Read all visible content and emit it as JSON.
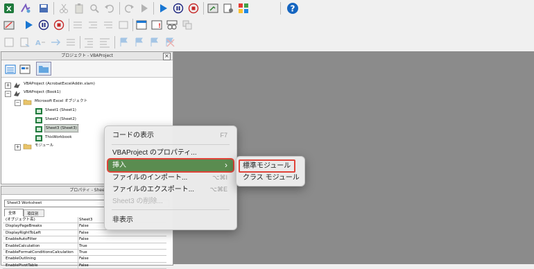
{
  "colors": {
    "highlight": "#5a8c50",
    "outline": "#e0443a",
    "code_bg": "#8b8b8b"
  },
  "toolbar": {
    "icons": [
      "excel-icon",
      "run-macro-icon",
      "save-icon",
      "cut-icon",
      "paste-icon",
      "find-icon",
      "undo-icon",
      "redo-icon",
      "play-icon",
      "run-icon",
      "pause-icon",
      "stop-icon",
      "design-mode-icon",
      "properties-icon",
      "toolbox-icon",
      "help-icon"
    ]
  },
  "project_pane": {
    "title": "プロジェクト - VBAProject",
    "close": "×",
    "tree": {
      "addin": "VBAProject (AcrobatExcelAddin.xlam)",
      "book": "VBAProject (Book1)",
      "objects_folder": "Microsoft Excel オブジェクト",
      "sheet1": "Sheet1 (Sheet1)",
      "sheet2": "Sheet2 (Sheet2)",
      "sheet3": "Sheet3 (Sheet3)",
      "thisworkbook": "ThisWorkbook",
      "modules_folder": "モジュール"
    }
  },
  "props_pane": {
    "title": "プロパティ - Shee",
    "object_select": "Sheet3  Worksheet",
    "tab_all": "全体",
    "tab_category": "項目別",
    "rows": [
      {
        "k": "(オブジェクト名)",
        "v": "Sheet3"
      },
      {
        "k": "DisplayPageBreaks",
        "v": "False"
      },
      {
        "k": "DisplayRightToLeft",
        "v": "False"
      },
      {
        "k": "EnableAutoFilter",
        "v": "False"
      },
      {
        "k": "EnableCalculation",
        "v": "True"
      },
      {
        "k": "EnableFormatConditionsCalculation",
        "v": "True"
      },
      {
        "k": "EnableOutlining",
        "v": "False"
      },
      {
        "k": "EnablePivotTable",
        "v": "False"
      }
    ]
  },
  "context_menu": {
    "view_code": "コードの表示",
    "view_code_sc": "F7",
    "project_props": "VBAProject のプロパティ...",
    "insert": "挿入",
    "insert_arrow": "›",
    "import": "ファイルのインポート...",
    "import_sc": "⌥⌘I",
    "export": "ファイルのエクスポート...",
    "export_sc": "⌥⌘E",
    "remove": "Sheet3 の削除...",
    "hide": "非表示"
  },
  "submenu": {
    "standard": "標準モジュール",
    "class": "クラス モジュール"
  }
}
